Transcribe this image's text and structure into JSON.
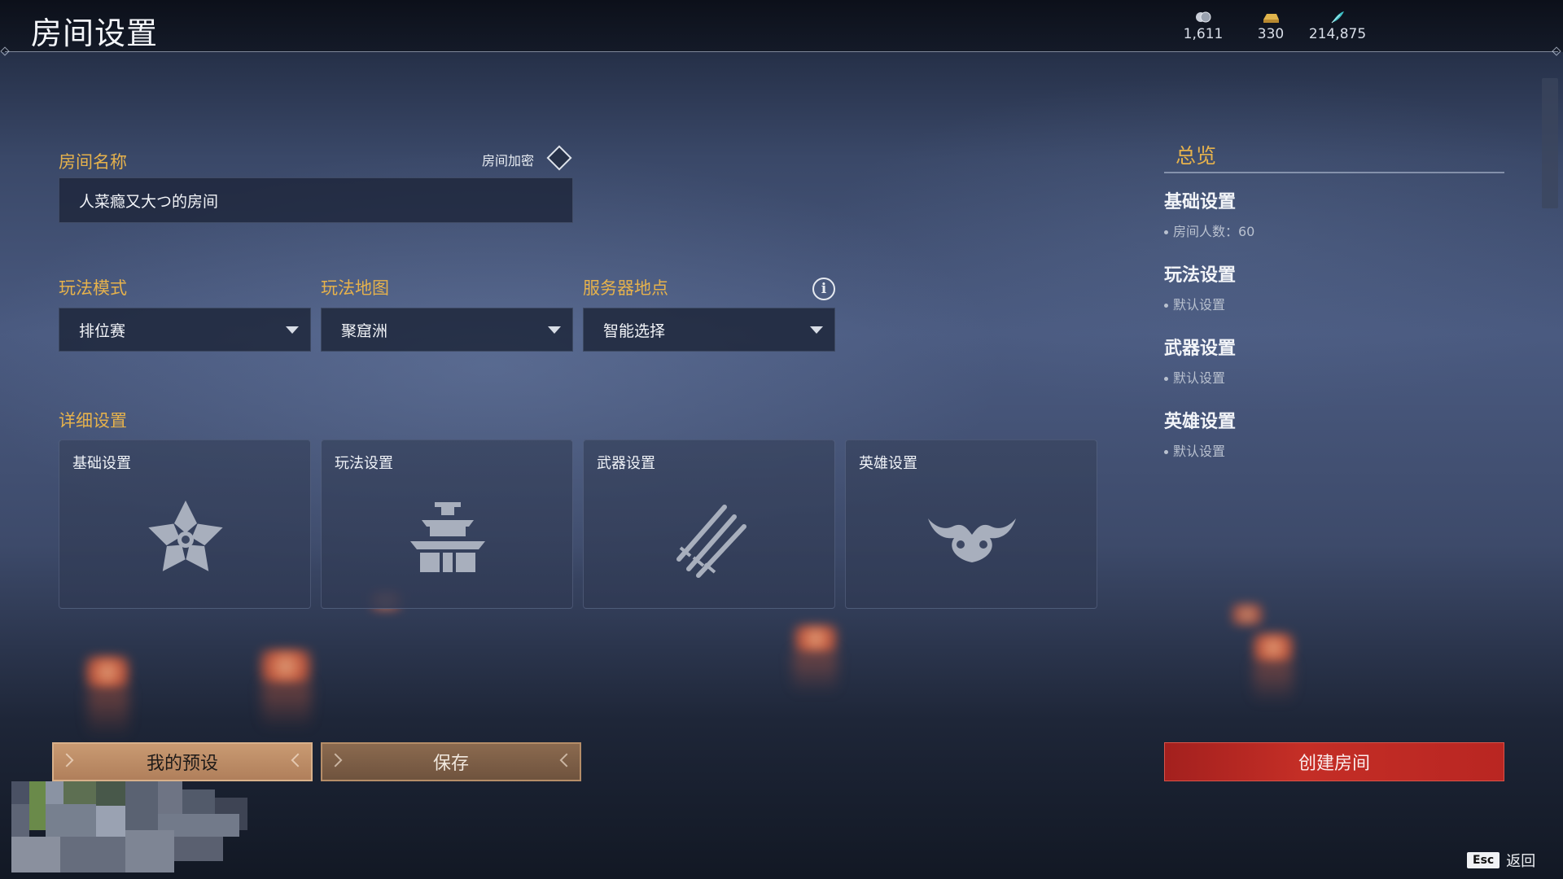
{
  "header": {
    "title": "房间设置",
    "currencies": [
      {
        "icon": "silver-coin-icon",
        "value": "1,611"
      },
      {
        "icon": "gold-ingot-icon",
        "value": "330"
      },
      {
        "icon": "jade-feather-icon",
        "value": "214,875"
      }
    ]
  },
  "room": {
    "name_label": "房间名称",
    "name_value": "人菜瘾又大つ的房间",
    "lock_label": "房间加密"
  },
  "selects": [
    {
      "label": "玩法模式",
      "value": "排位赛"
    },
    {
      "label": "玩法地图",
      "value": "聚窟洲"
    },
    {
      "label": "服务器地点",
      "value": "智能选择"
    }
  ],
  "details": {
    "label": "详细设置",
    "cards": [
      {
        "title": "基础设置",
        "icon": "flower-icon"
      },
      {
        "title": "玩法设置",
        "icon": "pagoda-icon"
      },
      {
        "title": "武器设置",
        "icon": "crossed-swords-icon"
      },
      {
        "title": "英雄设置",
        "icon": "hero-mask-icon"
      }
    ]
  },
  "overview": {
    "title": "总览",
    "sections": [
      {
        "heading": "基础设置",
        "detail": "房间人数：60"
      },
      {
        "heading": "玩法设置",
        "detail": "默认设置"
      },
      {
        "heading": "武器设置",
        "detail": "默认设置"
      },
      {
        "heading": "英雄设置",
        "detail": "默认设置"
      }
    ]
  },
  "buttons": {
    "preset": "我的预设",
    "save": "保存",
    "create": "创建房间"
  },
  "footer": {
    "esc_key": "Esc",
    "back_label": "返回"
  },
  "colors": {
    "accent_gold": "#e6b24c",
    "create_red": "#c42e26",
    "preset_tan": "#c99a72"
  }
}
